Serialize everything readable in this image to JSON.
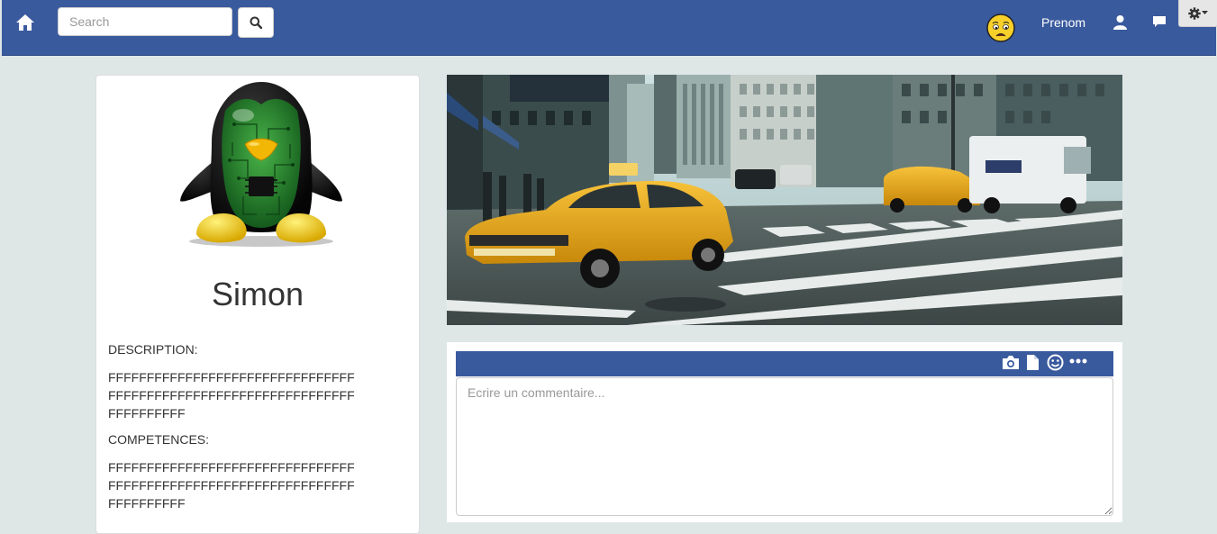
{
  "navbar": {
    "home_icon": "home-icon",
    "search": {
      "placeholder": "Search",
      "value": ""
    },
    "search_button_icon": "search-icon",
    "avatar_icon": "worried-face-emoji",
    "user_name": "Prenom",
    "profile_icon": "user-icon",
    "messages_icon": "comment-icon",
    "settings_icon": "gear-icon",
    "brand_color": "#3a5a9e"
  },
  "profile": {
    "avatar_icon": "circuit-penguin-avatar",
    "name": "Simon",
    "description_label": "DESCRIPTION:",
    "description_text": "FFFFFFFFFFFFFFFFFFFFFFFFFFFFFFFFFFFFFFFFFFFFFFFFFFFFFFFFFFFFFFFFFFFFFFFFFF",
    "competences_label": "COMPETENCES:",
    "competences_text": "FFFFFFFFFFFFFFFFFFFFFFFFFFFFFFFFFFFFFFFFFFFFFFFFFFFFFFFFFFFFFFFFFFFFFFFFFF"
  },
  "cover": {
    "image": "new-york-street-with-yellow-taxi"
  },
  "composer": {
    "tools": [
      "camera-icon",
      "file-icon",
      "smiley-icon",
      "more-icon"
    ],
    "placeholder": "Ecrire un commentaire...",
    "value": ""
  }
}
